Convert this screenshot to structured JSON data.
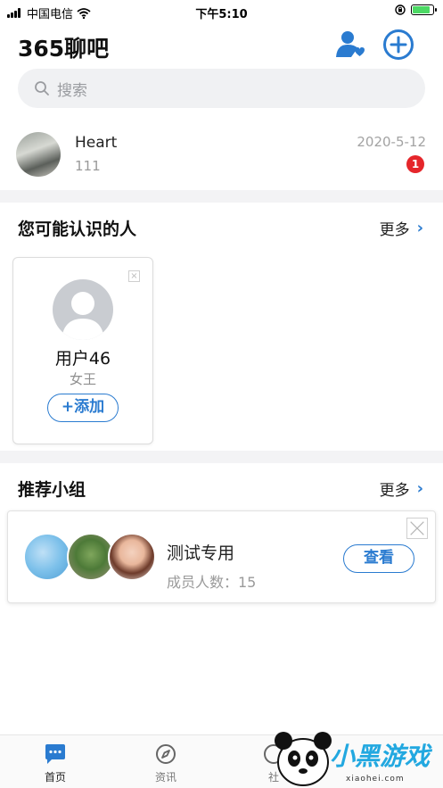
{
  "status_bar": {
    "carrier": "中国电信",
    "time": "下午5:10",
    "battery_level": 0.85
  },
  "header": {
    "title": "365聊吧",
    "contacts_icon": "user-heart-icon",
    "add_icon": "plus-circle-icon"
  },
  "search": {
    "placeholder": "搜索"
  },
  "chat": {
    "name": "Heart",
    "last_message": "111",
    "date": "2020-5-12",
    "unread": "1"
  },
  "people_section": {
    "title": "您可能认识的人",
    "more": "更多"
  },
  "person": {
    "name": "用户46",
    "role": "女王",
    "add_label": "+添加"
  },
  "groups_section": {
    "title": "推荐小组",
    "more": "更多"
  },
  "group": {
    "name": "测试专用",
    "members": "成员人数：15",
    "view_label": "查看"
  },
  "tabbar": {
    "tabs": [
      {
        "label": "首页"
      },
      {
        "label": "资讯"
      },
      {
        "label": "社"
      }
    ]
  },
  "watermark": {
    "text": "小黑游戏",
    "site": "xiaohei.com"
  },
  "colors": {
    "accent": "#2a7bd0",
    "badge": "#e5262b",
    "divider": "#f3f3f5"
  }
}
